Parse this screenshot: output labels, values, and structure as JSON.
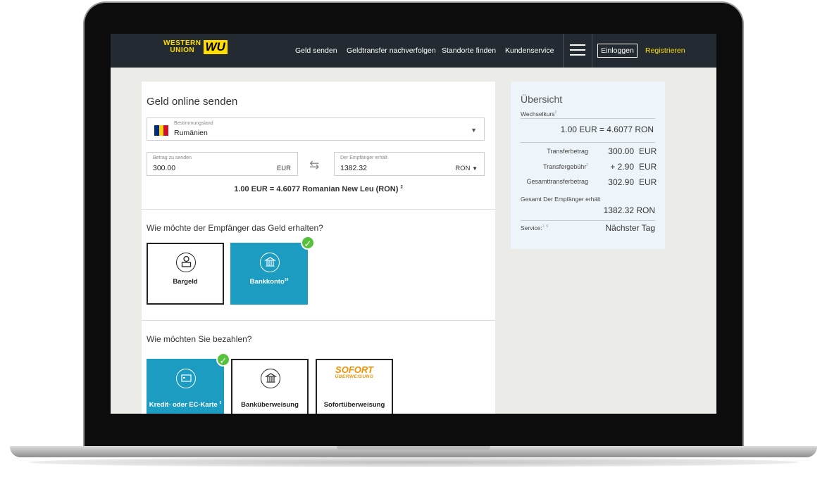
{
  "nav": {
    "logo_line1": "WESTERN",
    "logo_line2": "UNION",
    "logo_mark": "WU",
    "links": [
      "Geld senden",
      "Geldtransfer nachverfolgen",
      "Standorte finden",
      "Kundenservice"
    ],
    "login": "Einloggen",
    "register": "Registrieren"
  },
  "form": {
    "title": "Geld online senden",
    "destination": {
      "label": "Bestimmungsland",
      "value": "Rumänien"
    },
    "send": {
      "label": "Betrag zu senden",
      "value": "300.00",
      "currency": "EUR"
    },
    "receive": {
      "label": "Der Empfänger erhält",
      "value": "1382.32",
      "currency": "RON"
    },
    "rate_text": "1.00 EUR = 4.6077 Romanian New Leu (RON)",
    "rate_sup": "2"
  },
  "receive_section": {
    "question": "Wie möchte der Empfänger das Geld erhalten?",
    "options": [
      {
        "label": "Bargeld",
        "sup": "",
        "selected": false
      },
      {
        "label": "Bankkonto",
        "sup": "10",
        "selected": true
      }
    ]
  },
  "pay_section": {
    "question": "Wie möchten Sie bezahlen?",
    "options": [
      {
        "label": "Kredit- oder EC-Karte",
        "sup": "3",
        "selected": true
      },
      {
        "label": "Banküberweisung",
        "sup": "",
        "selected": false
      },
      {
        "label": "Sofortüberweisung",
        "sup": "",
        "selected": false
      }
    ],
    "sofort_logo_top": "SOFORT",
    "sofort_logo_bottom": "ÜBERWEISUNG"
  },
  "overview": {
    "title": "Übersicht",
    "rate_label": "Wechselkurs",
    "rate_sup": "2",
    "rate_value": "1.00 EUR = 4.6077 RON",
    "transfer_label": "Transferbetrag",
    "transfer_value": "300.00",
    "transfer_currency": "EUR",
    "fee_label": "Transfergebühr",
    "fee_sup": "2",
    "fee_value": "+ 2.90",
    "fee_currency": "EUR",
    "total_label": "Gesamttransferbetrag",
    "total_value": "302.90",
    "total_currency": "EUR",
    "receiver_label": "Gesamt Der Empfänger erhält",
    "receiver_value": "1382.32 RON",
    "service_label": "Service:",
    "service_sup": "1, 9",
    "service_value": "Nächster Tag"
  },
  "colors": {
    "nav_bg": "#232a31",
    "brand_yellow": "#ffdd00",
    "selected_tile": "#1c9cc0",
    "check_green": "#56c13a",
    "overview_bg": "#eef5fa",
    "flag": [
      "#002b7f",
      "#fcd116",
      "#ce1126"
    ]
  }
}
